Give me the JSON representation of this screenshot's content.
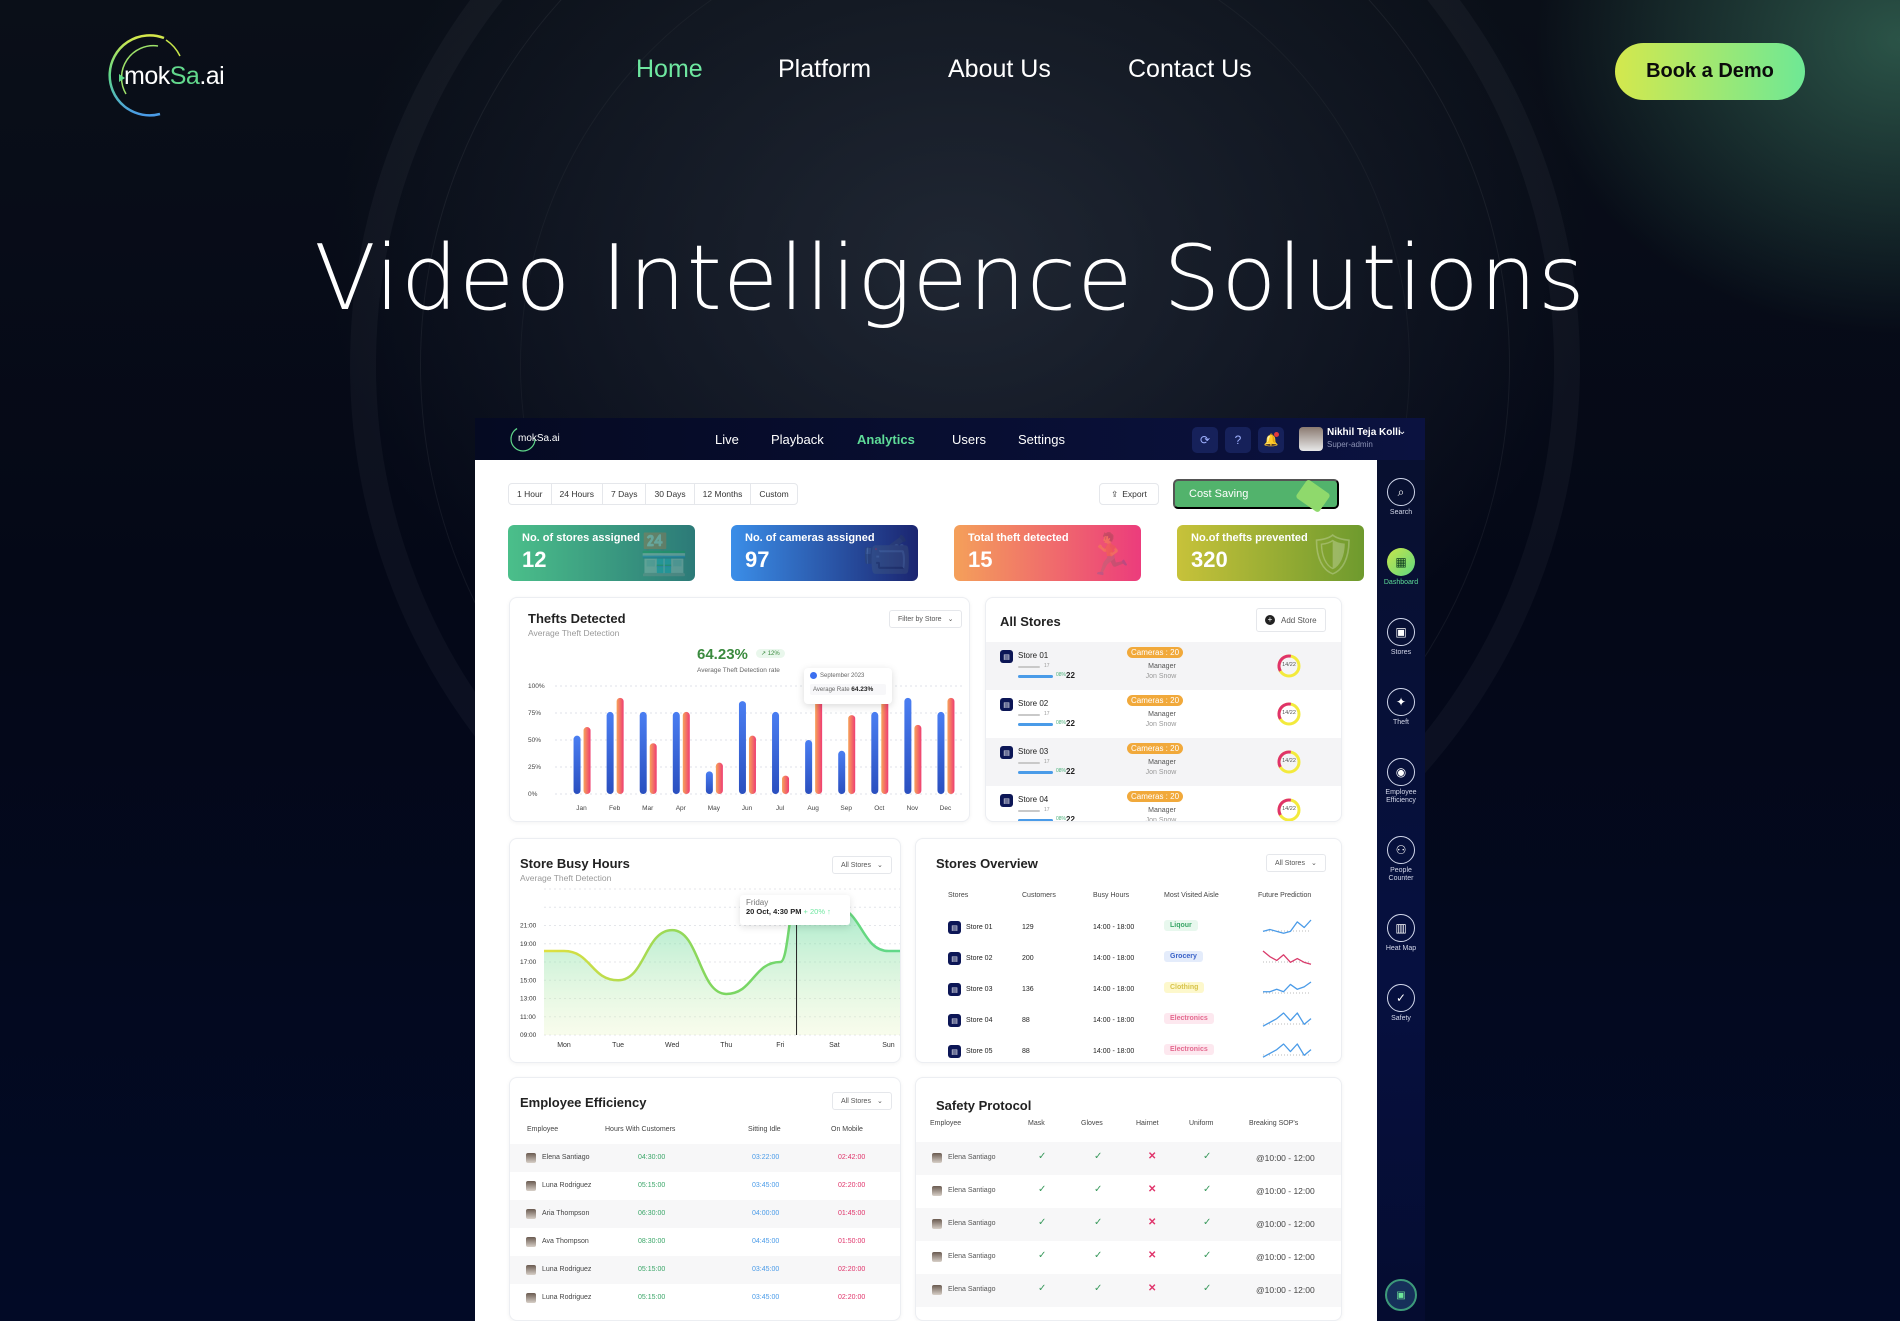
{
  "site": {
    "logo_text_left": "mok",
    "logo_text_accent": "Sa",
    "logo_text_right": ".ai",
    "nav": [
      {
        "label": "Home",
        "active": true
      },
      {
        "label": "Platform",
        "active": false
      },
      {
        "label": "About Us",
        "active": false
      },
      {
        "label": "Contact Us",
        "active": false
      }
    ],
    "cta_label": "Book a Demo",
    "hero_title": "Video Intelligence Solutions",
    "colors": {
      "accent": "#6ee7a0",
      "cta_start": "#d4e84d",
      "cta_end": "#6ee895",
      "background": "#020617"
    }
  },
  "dashboard": {
    "logo_text": "mokSa.ai",
    "tabs": [
      {
        "label": "Live",
        "active": false
      },
      {
        "label": "Playback",
        "active": false
      },
      {
        "label": "Analytics",
        "active": true
      },
      {
        "label": "Users",
        "active": false
      },
      {
        "label": "Settings",
        "active": false
      }
    ],
    "header_icons": [
      "refresh-icon",
      "help-icon",
      "notification-bell-icon"
    ],
    "user": {
      "name": "Nikhil Teja Kolli",
      "role": "Super-admin"
    },
    "time_ranges": [
      "1 Hour",
      "24 Hours",
      "7 Days",
      "30 Days",
      "12 Months",
      "Custom"
    ],
    "export_label": "Export",
    "cost_saving_label": "Cost Saving",
    "kpis": [
      {
        "label": "No. of stores assigned",
        "value": "12",
        "color_from": "#4bbf8a",
        "color_to": "#2c7a78",
        "icon": "store-icon"
      },
      {
        "label": "No. of cameras assigned",
        "value": "97",
        "color_from": "#3b8ee8",
        "color_to": "#1b2570",
        "icon": "camera-icon"
      },
      {
        "label": "Total theft detected",
        "value": "15",
        "color_from": "#f4a05a",
        "color_to": "#ec3c7c",
        "icon": "thief-icon"
      },
      {
        "label": "No.of thefts prevented",
        "value": "320",
        "color_from": "#c7c23a",
        "color_to": "#6e9a2e",
        "icon": "shield-icon"
      }
    ],
    "sidebar": [
      {
        "label": "Search",
        "icon": "search-icon",
        "active": false
      },
      {
        "label": "Dashboard",
        "icon": "dashboard-icon",
        "active": true
      },
      {
        "label": "Stores",
        "icon": "store-icon",
        "active": false
      },
      {
        "label": "Theft",
        "icon": "theft-icon",
        "active": false
      },
      {
        "label": "Employee Efficiency",
        "icon": "employee-icon",
        "active": false
      },
      {
        "label": "People Counter",
        "icon": "people-icon",
        "active": false
      },
      {
        "label": "Heat Map",
        "icon": "heatmap-icon",
        "active": false
      },
      {
        "label": "Safety",
        "icon": "safety-icon",
        "active": false
      }
    ],
    "thefts": {
      "title": "Thefts Detected",
      "subtitle": "Average Theft Detection",
      "filter_label": "Filter by Store",
      "big_value": "64.23%",
      "trend": "12%",
      "big_label": "Average Theft Detection rate",
      "tooltip": {
        "month": "September 2023",
        "label": "Average Rate",
        "value": "64.23%"
      }
    },
    "all_stores": {
      "title": "All Stores",
      "add_label": "Add Store",
      "rows": [
        {
          "name": "Store 01",
          "small_value": "17",
          "pct": "08%",
          "total": "22",
          "cameras": "Cameras : 20",
          "manager_label": "Manager",
          "manager": "Jon Snow",
          "ring": "14/22",
          "ring_fraction": 0.36
        },
        {
          "name": "Store 02",
          "small_value": "17",
          "pct": "08%",
          "total": "22",
          "cameras": "Cameras : 20",
          "manager_label": "Manager",
          "manager": "Jon Snow",
          "ring": "14/22",
          "ring_fraction": 0.36
        },
        {
          "name": "Store 03",
          "small_value": "17",
          "pct": "08%",
          "total": "22",
          "cameras": "Cameras : 20",
          "manager_label": "Manager",
          "manager": "Jon Snow",
          "ring": "14/22",
          "ring_fraction": 0.36
        },
        {
          "name": "Store 04",
          "small_value": "17",
          "pct": "08%",
          "total": "22",
          "cameras": "Cameras : 20",
          "manager_label": "Manager",
          "manager": "Jon Snow",
          "ring": "14/22",
          "ring_fraction": 0.36
        }
      ]
    },
    "busy_hours": {
      "title": "Store Busy Hours",
      "subtitle": "Average Theft Detection",
      "filter_label": "All Stores",
      "tooltip": {
        "day": "Friday",
        "datetime": "20 Oct, 4:30 PM",
        "change": "+ 20% ↑"
      }
    },
    "stores_overview": {
      "title": "Stores Overview",
      "filter_label": "All Stores",
      "headers": [
        "Stores",
        "Customers",
        "Busy Hours",
        "Most Visited Aisle",
        "Future Prediction"
      ],
      "rows": [
        {
          "store": "Store 01",
          "customers": "129",
          "busy": "14:00 - 18:00",
          "aisle": "Liqour",
          "aisle_bg": "#e8f8ee",
          "aisle_fg": "#3aa668",
          "trend_color": "#4a9be8",
          "trend": [
            3,
            4,
            3,
            2,
            3,
            8,
            5,
            9
          ]
        },
        {
          "store": "Store 02",
          "customers": "200",
          "busy": "14:00 - 18:00",
          "aisle": "Grocery",
          "aisle_bg": "#e4ecfb",
          "aisle_fg": "#3a62c8",
          "trend_color": "#d93a6a",
          "trend": [
            9,
            6,
            4,
            7,
            3,
            5,
            3,
            2
          ]
        },
        {
          "store": "Store 03",
          "customers": "136",
          "busy": "14:00 - 18:00",
          "aisle": "Clothing",
          "aisle_bg": "#fdf8cc",
          "aisle_fg": "#d8c34a",
          "trend_color": "#4a9be8",
          "trend": [
            3,
            3,
            4,
            3,
            6,
            4,
            5,
            7
          ]
        },
        {
          "store": "Store 04",
          "customers": "88",
          "busy": "14:00 - 18:00",
          "aisle": "Electronics",
          "aisle_bg": "#fde8ef",
          "aisle_fg": "#e46a90",
          "trend_color": "#4a9be8",
          "trend": [
            2,
            4,
            6,
            9,
            5,
            9,
            3,
            6
          ]
        },
        {
          "store": "Store 05",
          "customers": "88",
          "busy": "14:00 - 18:00",
          "aisle": "Electronics",
          "aisle_bg": "#fde8ef",
          "aisle_fg": "#e46a90",
          "trend_color": "#4a9be8",
          "trend": [
            2,
            4,
            6,
            9,
            5,
            9,
            3,
            6
          ]
        }
      ]
    },
    "employee_efficiency": {
      "title": "Employee Efficiency",
      "filter_label": "All Stores",
      "headers": [
        "Employee",
        "Hours With Customers",
        "Sitting Idle",
        "On Mobile"
      ],
      "rows": [
        {
          "name": "Elena Santiago",
          "with_customers": "04:30:00",
          "idle": "03:22:00",
          "mobile": "02:42:00"
        },
        {
          "name": "Luna Rodriguez",
          "with_customers": "05:15:00",
          "idle": "03:45:00",
          "mobile": "02:20:00"
        },
        {
          "name": "Aria Thompson",
          "with_customers": "06:30:00",
          "idle": "04:00:00",
          "mobile": "01:45:00"
        },
        {
          "name": "Ava Thompson",
          "with_customers": "08:30:00",
          "idle": "04:45:00",
          "mobile": "01:50:00"
        },
        {
          "name": "Luna Rodriguez",
          "with_customers": "05:15:00",
          "idle": "03:45:00",
          "mobile": "02:20:00"
        },
        {
          "name": "Luna Rodriguez",
          "with_customers": "05:15:00",
          "idle": "03:45:00",
          "mobile": "02:20:00"
        }
      ]
    },
    "safety": {
      "title": "Safety Protocol",
      "headers": [
        "Employee",
        "Mask",
        "Gloves",
        "Hairnet",
        "Uniform",
        "Breaking SOP's"
      ],
      "rows": [
        {
          "name": "Elena Santiago",
          "mask": true,
          "gloves": true,
          "hairnet": false,
          "uniform": true,
          "sop": "@10:00 - 12:00"
        },
        {
          "name": "Elena Santiago",
          "mask": true,
          "gloves": true,
          "hairnet": false,
          "uniform": true,
          "sop": "@10:00 - 12:00"
        },
        {
          "name": "Elena Santiago",
          "mask": true,
          "gloves": true,
          "hairnet": false,
          "uniform": true,
          "sop": "@10:00 - 12:00"
        },
        {
          "name": "Elena Santiago",
          "mask": true,
          "gloves": true,
          "hairnet": false,
          "uniform": true,
          "sop": "@10:00 - 12:00"
        },
        {
          "name": "Elena Santiago",
          "mask": true,
          "gloves": true,
          "hairnet": false,
          "uniform": true,
          "sop": "@10:00 - 12:00"
        }
      ]
    }
  },
  "chart_data": [
    {
      "type": "bar",
      "title": "Thefts Detected",
      "categories": [
        "Jan",
        "Feb",
        "Mar",
        "Apr",
        "May",
        "Jun",
        "Jul",
        "Aug",
        "Sep",
        "Oct",
        "Nov",
        "Dec"
      ],
      "series": [
        {
          "name": "blue",
          "color": "#3b6ff0",
          "values": [
            54,
            76,
            76,
            76,
            21,
            86,
            76,
            50,
            40,
            76,
            89,
            76
          ]
        },
        {
          "name": "red",
          "color": "#f04e6e",
          "values": [
            62,
            89,
            47,
            76,
            29,
            54,
            17,
            89,
            73,
            89,
            64,
            89
          ]
        }
      ],
      "yticks": [
        "0%",
        "25%",
        "50%",
        "75%",
        "100%"
      ],
      "ylim": [
        0,
        100
      ],
      "grid": true
    },
    {
      "type": "area",
      "title": "Store Busy Hours",
      "categories": [
        "Mon",
        "Tue",
        "Wed",
        "Thu",
        "Fri",
        "Sat",
        "Sun"
      ],
      "yticks": [
        "09:00",
        "11:00",
        "13:00",
        "15:00",
        "17:00",
        "19:00",
        "21:00"
      ],
      "ylim": [
        9,
        25
      ],
      "x": [
        0,
        1,
        2,
        3,
        4,
        4.3,
        5,
        6
      ],
      "values": [
        18.2,
        15.0,
        20.5,
        13.5,
        17.0,
        23.5,
        23.0,
        18.2
      ],
      "highlight_index": 5
    }
  ]
}
